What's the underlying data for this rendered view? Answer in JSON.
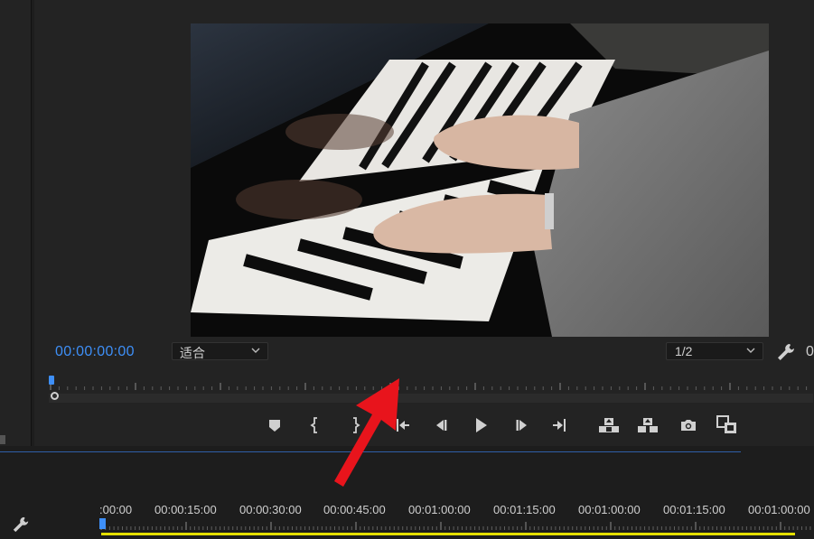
{
  "colors": {
    "accent_blue": "#3e8ff7",
    "background": "#1d1d1d",
    "panel": "#232323",
    "yellow_bar": "#e5e000",
    "annotation_red": "#e8141c"
  },
  "program_monitor": {
    "timecode": "00:00:00:00",
    "fit_dropdown": {
      "value": "适合",
      "icon": "chevron-down-icon"
    },
    "resolution_dropdown": {
      "value": "1/2",
      "icon": "chevron-down-icon"
    },
    "settings_icon": "wrench-icon",
    "right_cut_label": "0",
    "video_content": "piano-hands-frame"
  },
  "transport_controls": [
    {
      "name": "add-marker-button",
      "icon": "marker-icon"
    },
    {
      "name": "mark-in-button",
      "icon": "mark-in-icon"
    },
    {
      "name": "mark-out-button",
      "icon": "mark-out-icon"
    },
    {
      "name": "go-to-in-button",
      "icon": "go-to-in-icon"
    },
    {
      "name": "step-back-button",
      "icon": "step-back-icon"
    },
    {
      "name": "play-button",
      "icon": "play-icon"
    },
    {
      "name": "step-forward-button",
      "icon": "step-forward-icon"
    },
    {
      "name": "go-to-out-button",
      "icon": "go-to-out-icon"
    },
    {
      "name": "lift-button",
      "icon": "lift-icon"
    },
    {
      "name": "extract-button",
      "icon": "extract-icon"
    },
    {
      "name": "export-frame-button",
      "icon": "camera-icon"
    },
    {
      "name": "comparison-view-button",
      "icon": "comparison-view-icon"
    }
  ],
  "timeline": {
    "settings_icon": "wrench-icon",
    "ruler_labels": [
      ":00:00",
      "00:00:15:00",
      "00:00:30:00",
      "00:00:45:00",
      "00:01:00:00",
      "00:01:15:00",
      "00:01:00:00",
      "00:01:15:00",
      "00:01:00:00"
    ]
  },
  "annotation": {
    "icon": "red-arrow-icon"
  }
}
